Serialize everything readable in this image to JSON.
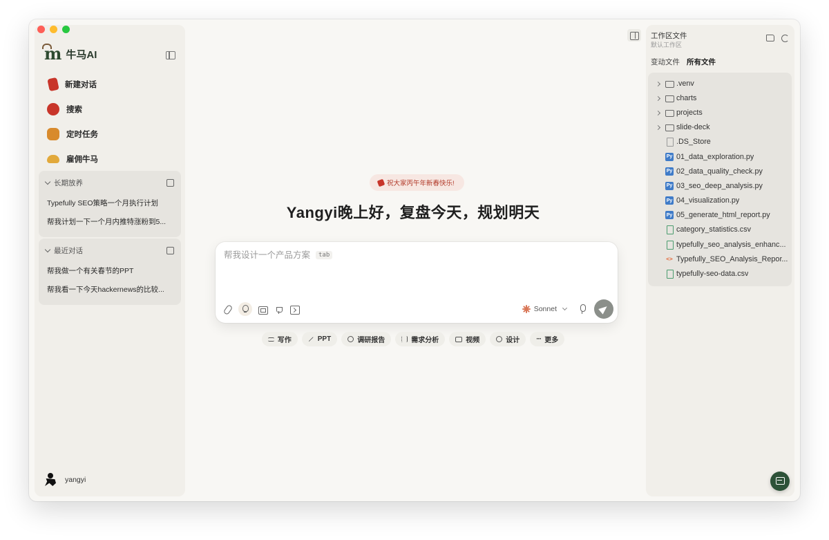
{
  "window": {
    "traffic_colors": [
      "#fe5f57",
      "#febc2e",
      "#28c840"
    ]
  },
  "sidebar": {
    "brand_mark": "m",
    "brand_name": "牛马AI",
    "nav": [
      {
        "label": "新建对话",
        "icon": "red-envelope-icon",
        "color": "#c8352a"
      },
      {
        "label": "搜索",
        "icon": "lantern-icon",
        "color": "#c8352a"
      },
      {
        "label": "定时任务",
        "icon": "lion-dance-icon",
        "color": "#d88a2c"
      },
      {
        "label": "雇佣牛马",
        "icon": "gold-ingot-icon",
        "color": "#e2a93b"
      }
    ],
    "groups": [
      {
        "title": "长期放养",
        "items": [
          "Typefully SEO策略一个月执行计划",
          "帮我计划一下一个月内推特涨粉到5..."
        ]
      },
      {
        "title": "最近对话",
        "items": [
          "帮我做一个有关春节的PPT",
          "帮我看一下今天hackernews的比较..."
        ]
      }
    ],
    "user": {
      "name": "yangyi"
    }
  },
  "main": {
    "festival": "祝大家丙午年新春快乐!",
    "greeting": "Yangyi晚上好，复盘今天，规划明天",
    "composer": {
      "placeholder": "帮我设计一个产品方案",
      "tab_hint": "tab",
      "model": "Sonnet"
    },
    "quick_actions": [
      {
        "label": "写作",
        "icon": "pen-lines-icon"
      },
      {
        "label": "PPT",
        "icon": "magic-wand-icon"
      },
      {
        "label": "调研报告",
        "icon": "search-icon"
      },
      {
        "label": "需求分析",
        "icon": "list-icon"
      },
      {
        "label": "视频",
        "icon": "video-icon"
      },
      {
        "label": "设计",
        "icon": "palette-icon"
      },
      {
        "label": "更多",
        "icon": "more-icon"
      }
    ]
  },
  "right_panel": {
    "title": "工作区文件",
    "subtitle": "默认工作区",
    "tabs": [
      "变动文件",
      "所有文件"
    ],
    "active_tab": 1,
    "files": [
      {
        "name": ".venv",
        "type": "folder"
      },
      {
        "name": "charts",
        "type": "folder"
      },
      {
        "name": "projects",
        "type": "folder"
      },
      {
        "name": "slide-deck",
        "type": "folder"
      },
      {
        "name": ".DS_Store",
        "type": "file"
      },
      {
        "name": "01_data_exploration.py",
        "type": "py"
      },
      {
        "name": "02_data_quality_check.py",
        "type": "py"
      },
      {
        "name": "03_seo_deep_analysis.py",
        "type": "py"
      },
      {
        "name": "04_visualization.py",
        "type": "py"
      },
      {
        "name": "05_generate_html_report.py",
        "type": "py"
      },
      {
        "name": "category_statistics.csv",
        "type": "csv"
      },
      {
        "name": "typefully_seo_analysis_enhanc...",
        "type": "csv"
      },
      {
        "name": "Typefully_SEO_Analysis_Repor...",
        "type": "html"
      },
      {
        "name": "typefully-seo-data.csv",
        "type": "csv"
      }
    ]
  }
}
